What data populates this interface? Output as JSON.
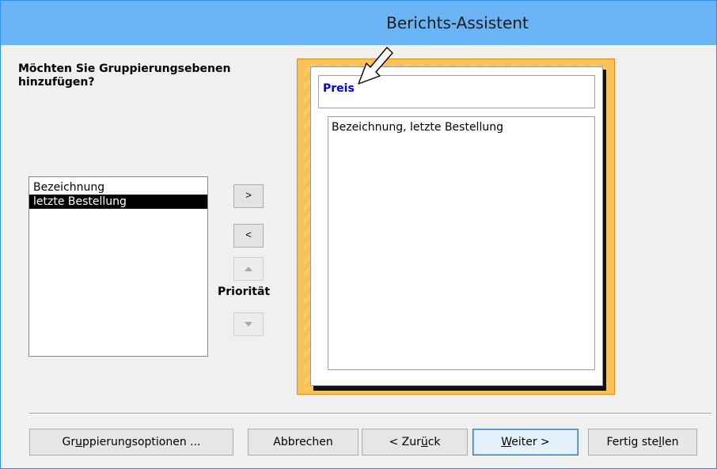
{
  "window": {
    "title": "Berichts-Assistent"
  },
  "question": "Möchten Sie Gruppierungsebenen hinzufügen?",
  "fields_list": {
    "items": [
      "Bezeichnung",
      "letzte Bestellung"
    ],
    "selected_index": 1
  },
  "controls": {
    "add_label": ">",
    "remove_label": "<",
    "priority_label": "Priorität"
  },
  "preview": {
    "group_field": "Preis",
    "detail_fields": "Bezeichnung, letzte Bestellung"
  },
  "buttons": {
    "grouping_options": {
      "pre": "Gr",
      "ul": "u",
      "post": "ppierungsoptionen ..."
    },
    "cancel": "Abbrechen",
    "back": {
      "pre": "< Zur",
      "ul": "ü",
      "post": "ck"
    },
    "next": {
      "pre": "",
      "ul": "W",
      "post": "eiter >"
    },
    "finish": {
      "pre": "Fertig ste",
      "ul": "l",
      "post": "len"
    }
  },
  "colors": {
    "titlebar": "#6ab4f5",
    "preview_frame": "#f7c35a",
    "group_label": "#0000ee",
    "selection": "#000000"
  }
}
